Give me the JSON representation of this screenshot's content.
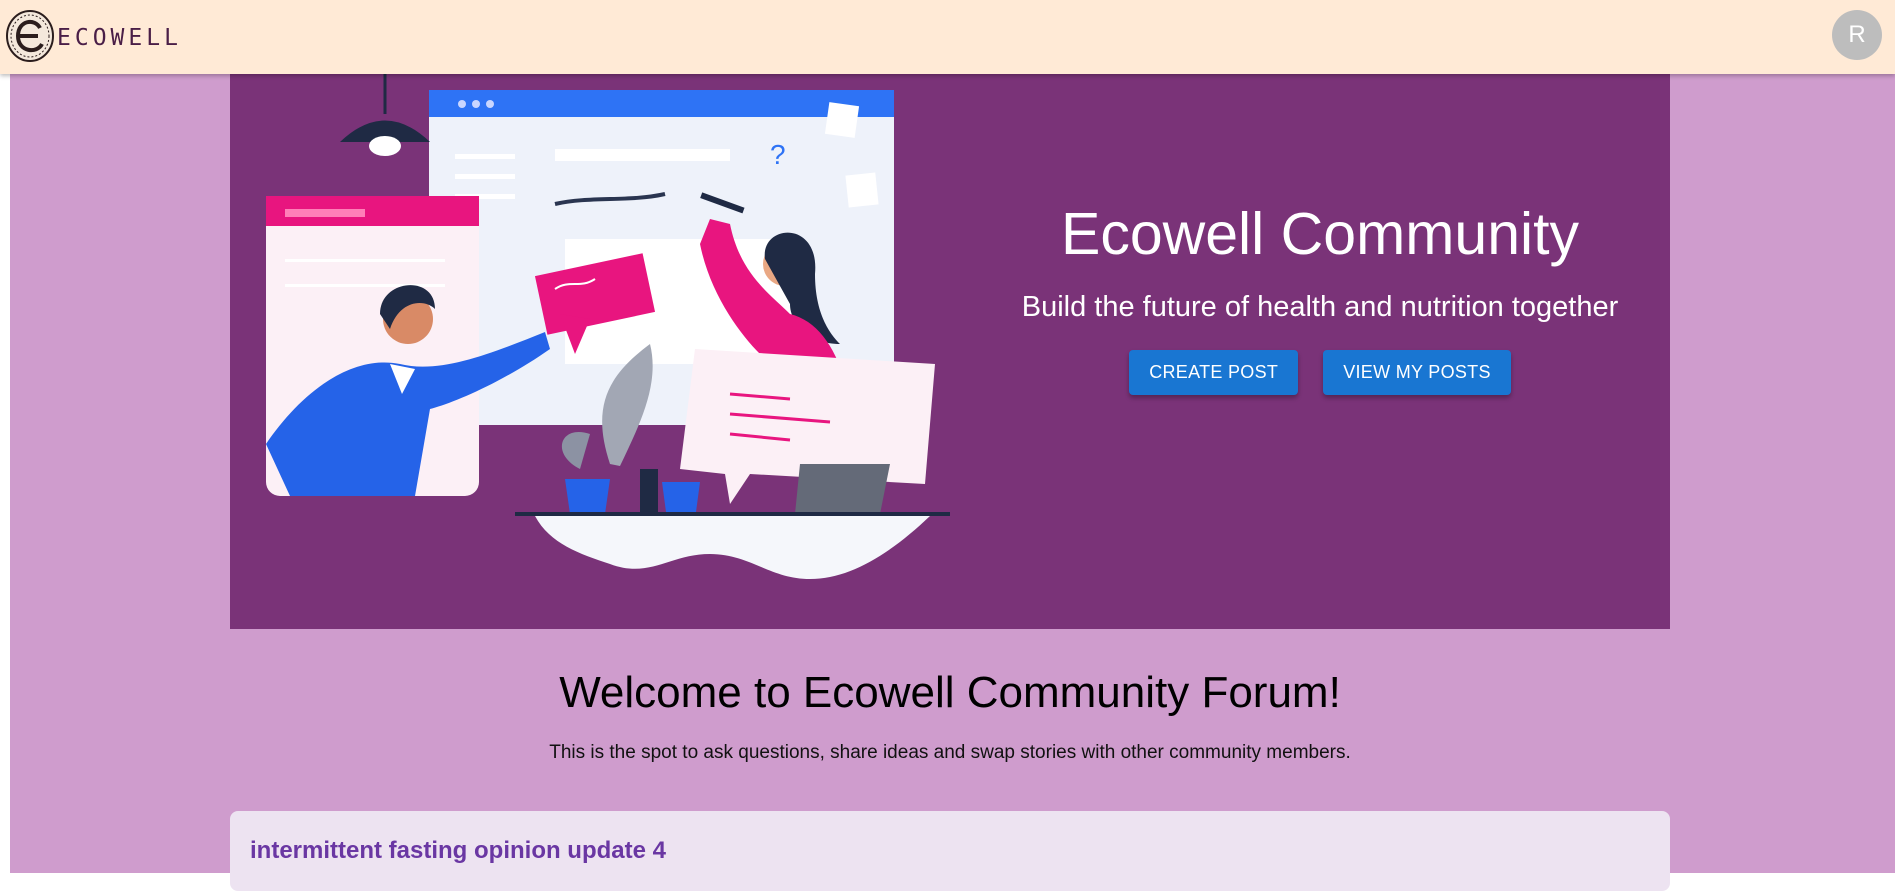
{
  "header": {
    "logo_text": "ECOWELL",
    "avatar_initial": "R"
  },
  "hero": {
    "title": "Ecowell Community",
    "subtitle": "Build the future of health and nutrition together",
    "create_post_label": "CREATE POST",
    "view_posts_label": "VIEW MY POSTS"
  },
  "welcome": {
    "title": "Welcome to Ecowell Community Forum!",
    "subtitle": "This is the spot to ask questions, share ideas and swap stories with other community members."
  },
  "posts": [
    {
      "title": "intermittent fasting opinion update 4"
    }
  ],
  "colors": {
    "appbar": "#ffead6",
    "page_background": "#cf9ccd",
    "hero_background": "#7a3378",
    "button": "#1976d2",
    "post_title": "#6a37a3"
  }
}
